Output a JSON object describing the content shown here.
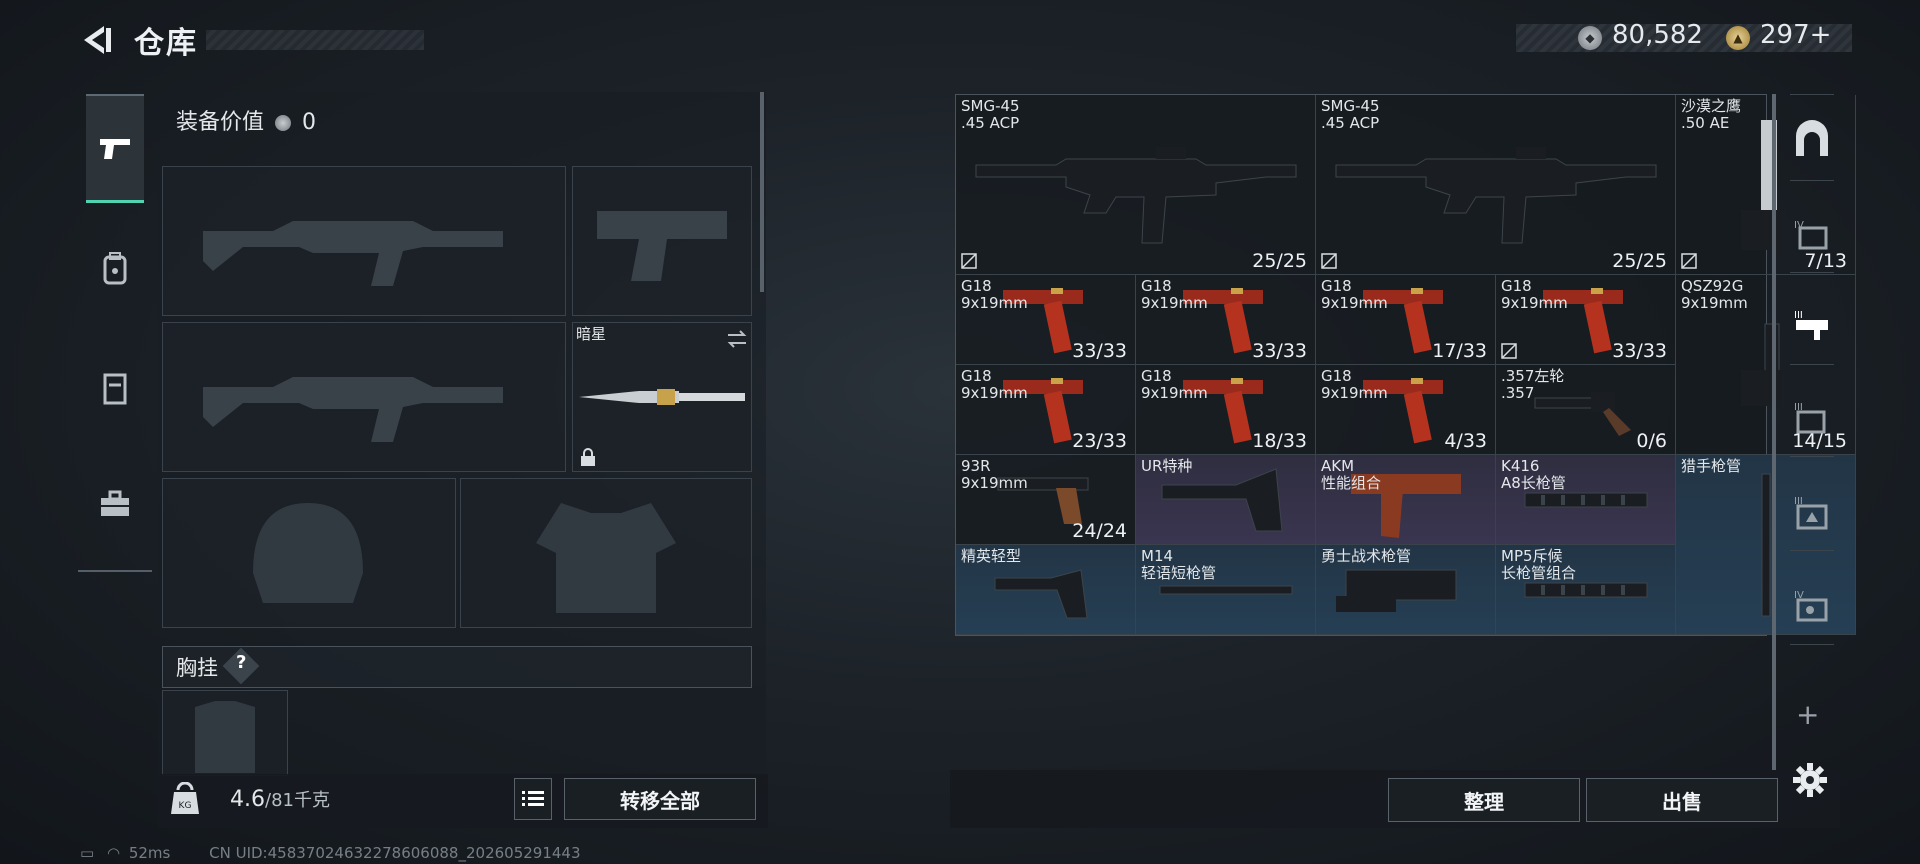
{
  "header": {
    "title": "仓库"
  },
  "currency": {
    "silver": "80,582",
    "gold": "297+"
  },
  "left": {
    "equip_value_label": "装备价值",
    "equip_value": "0",
    "knife_name": "暗星",
    "chest_label": "胸挂",
    "chest_help": "?",
    "weight_current": "4.6",
    "weight_max": "/81千克",
    "transfer_all": "转移全部"
  },
  "grid": {
    "items": [
      {
        "name": "SMG-45\n.45 ACP",
        "ammo": "25/25",
        "nodrop": true,
        "bg": "dark",
        "icon": "smg"
      },
      {
        "name": "SMG-45\n.45 ACP",
        "ammo": "25/25",
        "nodrop": true,
        "bg": "dark",
        "icon": "smg"
      },
      {
        "name": "沙漠之鹰\n.50 AE",
        "ammo": "7/13",
        "nodrop": true,
        "bg": "dark",
        "icon": "deagle"
      },
      {
        "name": "G18\n9x19mm",
        "ammo": "33/33",
        "nodrop": false,
        "bg": "dark",
        "icon": "g18"
      },
      {
        "name": "G18\n9x19mm",
        "ammo": "33/33",
        "nodrop": false,
        "bg": "dark",
        "icon": "g18"
      },
      {
        "name": "G18\n9x19mm",
        "ammo": "17/33",
        "nodrop": false,
        "bg": "dark",
        "icon": "g18"
      },
      {
        "name": "G18\n9x19mm",
        "ammo": "33/33",
        "nodrop": true,
        "bg": "dark",
        "icon": "g18"
      },
      {
        "name": "QSZ92G\n9x19mm",
        "ammo": "",
        "nodrop": false,
        "bg": "dark",
        "icon": "qsz"
      },
      {
        "name": "G18\n9x19mm",
        "ammo": "23/33",
        "nodrop": false,
        "bg": "dark",
        "icon": "g18"
      },
      {
        "name": "G18\n9x19mm",
        "ammo": "18/33",
        "nodrop": false,
        "bg": "dark",
        "icon": "g18"
      },
      {
        "name": "G18\n9x19mm",
        "ammo": "4/33",
        "nodrop": false,
        "bg": "dark",
        "icon": "g18"
      },
      {
        "name": ".357左轮\n.357",
        "ammo": "0/6",
        "nodrop": false,
        "bg": "dark",
        "icon": "revolver"
      },
      {
        "name": "",
        "ammo": "14/15",
        "nodrop": false,
        "bg": "dark",
        "icon": "none"
      },
      {
        "name": "93R\n9x19mm",
        "ammo": "24/24",
        "nodrop": false,
        "bg": "dark",
        "icon": "pistol"
      },
      {
        "name": "UR特种",
        "ammo": "",
        "nodrop": false,
        "bg": "purple",
        "icon": "stock"
      },
      {
        "name": "AKM\n性能组合",
        "ammo": "",
        "nodrop": false,
        "bg": "purple",
        "icon": "grip"
      },
      {
        "name": "K416\nA8长枪管",
        "ammo": "",
        "nodrop": false,
        "bg": "purple",
        "icon": "rail"
      },
      {
        "name": "猎手枪管",
        "ammo": "",
        "nodrop": false,
        "bg": "blue",
        "icon": "barrel"
      },
      {
        "name": "精英轻型",
        "ammo": "",
        "nodrop": false,
        "bg": "blue",
        "icon": "stock2"
      },
      {
        "name": "M14\n轻语短枪管",
        "ammo": "",
        "nodrop": false,
        "bg": "blue",
        "icon": "shortbarrel"
      },
      {
        "name": "勇士战术枪管",
        "ammo": "",
        "nodrop": false,
        "bg": "blue",
        "icon": "handguard"
      },
      {
        "name": "MP5斥候\n长枪管组合",
        "ammo": "",
        "nodrop": false,
        "bg": "blue",
        "icon": "rail"
      }
    ]
  },
  "actions": {
    "sort": "整理",
    "sell": "出售"
  },
  "status": {
    "ping": "52ms",
    "uid": "CN UID:45837024632278606088_202605291443"
  },
  "colors": {
    "accent": "#4fd3b0",
    "purple_tier": "#3a3550",
    "blue_tier": "#263f54"
  }
}
